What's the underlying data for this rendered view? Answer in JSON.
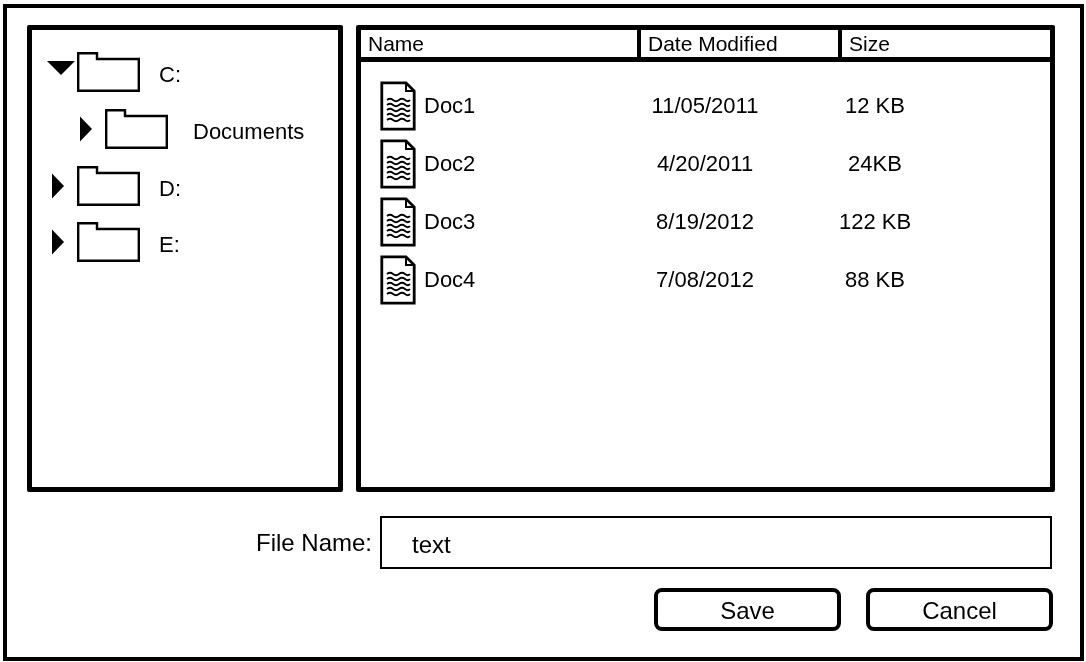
{
  "folder_tree": [
    {
      "label": "C:",
      "expanded": true,
      "children": [
        {
          "label": "Documents",
          "expanded": false
        }
      ]
    },
    {
      "label": "D:",
      "expanded": false
    },
    {
      "label": "E:",
      "expanded": false
    }
  ],
  "file_list": {
    "columns": [
      "Name",
      "Date Modified",
      "Size"
    ],
    "rows": [
      {
        "name": "Doc1",
        "date_modified": "11/05/2011",
        "size": "12 KB"
      },
      {
        "name": "Doc2",
        "date_modified": "4/20/2011",
        "size": "24KB"
      },
      {
        "name": "Doc3",
        "date_modified": "8/19/2012",
        "size": "122 KB"
      },
      {
        "name": "Doc4",
        "date_modified": "7/08/2012",
        "size": "88 KB"
      }
    ]
  },
  "file_name_field": {
    "label": "File Name:",
    "value": "text"
  },
  "buttons": [
    "Save",
    "Cancel"
  ]
}
